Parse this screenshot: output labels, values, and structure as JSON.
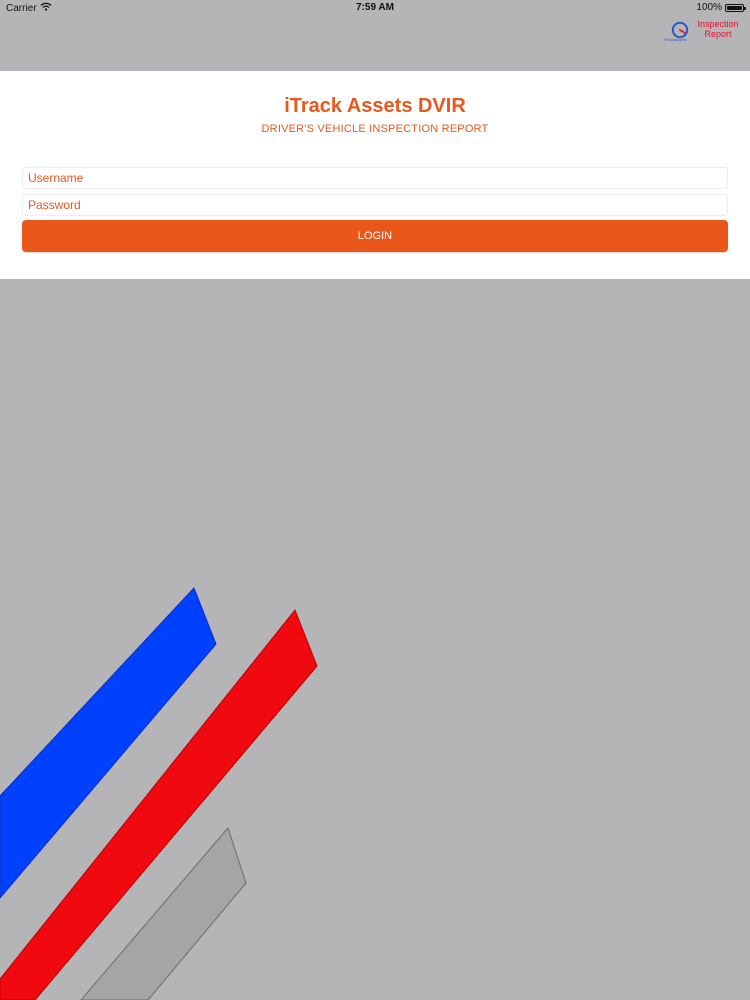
{
  "status_bar": {
    "carrier": "Carrier",
    "time": "7:59 AM",
    "battery_percent": "100%"
  },
  "brand": {
    "logo_text_line1": "Inspection",
    "logo_text_line2": "Report",
    "logo_small_text": "iTrackAssets"
  },
  "login": {
    "title": "iTrack Assets DVIR",
    "subtitle": "DRIVER'S VEHICLE INSPECTION REPORT",
    "username_placeholder": "Username",
    "password_placeholder": "Password",
    "login_label": "LOGIN"
  },
  "colors": {
    "background": "#b5b4b7",
    "accent": "#ea571b",
    "stripe_blue": "#0041ff",
    "stripe_red": "#f00a10",
    "stripe_gray": "#a4a5a7"
  },
  "icons": {
    "wifi": "wifi-icon",
    "battery": "battery-icon"
  }
}
